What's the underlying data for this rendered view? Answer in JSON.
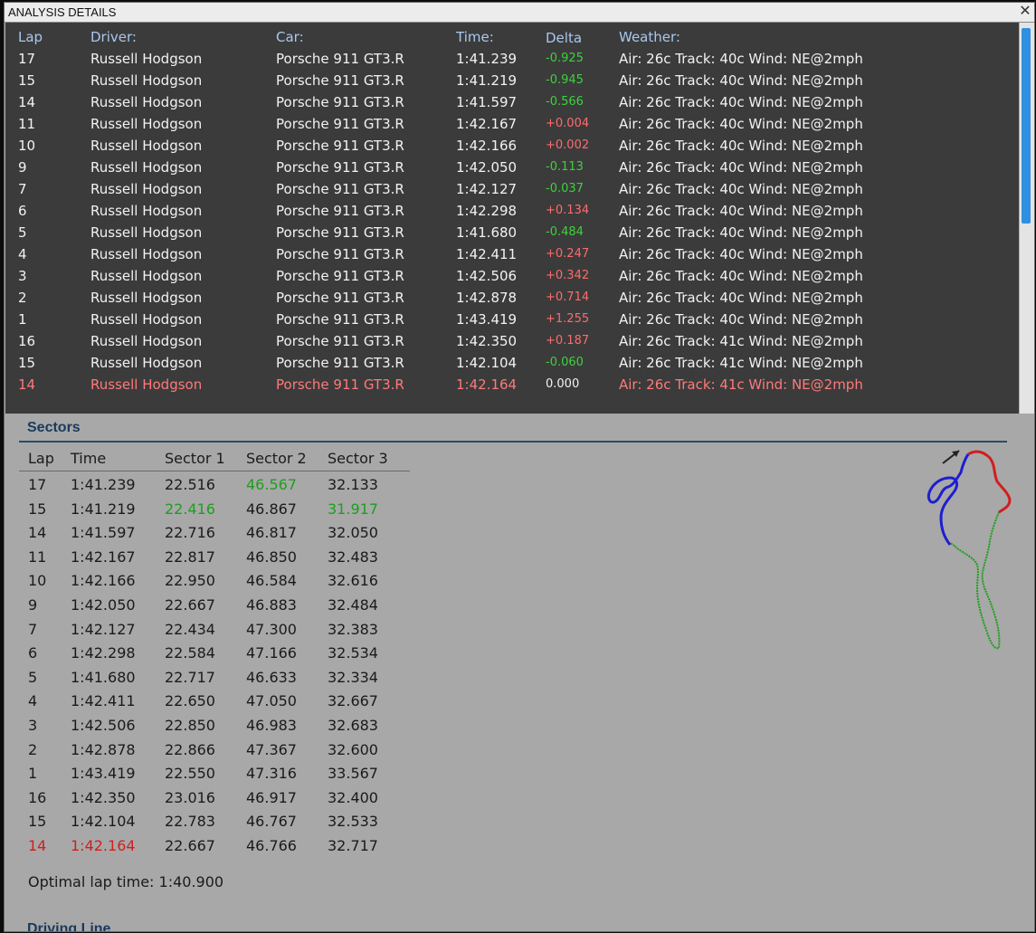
{
  "window": {
    "title": "ANALYSIS DETAILS",
    "close_glyph": "✕"
  },
  "laps": {
    "headers": {
      "lap": "Lap",
      "driver": "Driver:",
      "car": "Car:",
      "time": "Time:",
      "delta": "Delta",
      "weather": "Weather:"
    },
    "rows": [
      {
        "lap": "17",
        "driver": "Russell Hodgson",
        "car": "Porsche 911 GT3.R",
        "time": "1:41.239",
        "delta": "-0.925",
        "weather": "Air: 26c Track: 40c Wind: NE@2mph"
      },
      {
        "lap": "15",
        "driver": "Russell Hodgson",
        "car": "Porsche 911 GT3.R",
        "time": "1:41.219",
        "delta": "-0.945",
        "weather": "Air: 26c Track: 40c Wind: NE@2mph"
      },
      {
        "lap": "14",
        "driver": "Russell Hodgson",
        "car": "Porsche 911 GT3.R",
        "time": "1:41.597",
        "delta": "-0.566",
        "weather": "Air: 26c Track: 40c Wind: NE@2mph"
      },
      {
        "lap": "11",
        "driver": "Russell Hodgson",
        "car": "Porsche 911 GT3.R",
        "time": "1:42.167",
        "delta": "+0.004",
        "weather": "Air: 26c Track: 40c Wind: NE@2mph"
      },
      {
        "lap": "10",
        "driver": "Russell Hodgson",
        "car": "Porsche 911 GT3.R",
        "time": "1:42.166",
        "delta": "+0.002",
        "weather": "Air: 26c Track: 40c Wind: NE@2mph"
      },
      {
        "lap": "9",
        "driver": "Russell Hodgson",
        "car": "Porsche 911 GT3.R",
        "time": "1:42.050",
        "delta": "-0.113",
        "weather": "Air: 26c Track: 40c Wind: NE@2mph"
      },
      {
        "lap": "7",
        "driver": "Russell Hodgson",
        "car": "Porsche 911 GT3.R",
        "time": "1:42.127",
        "delta": "-0.037",
        "weather": "Air: 26c Track: 40c Wind: NE@2mph"
      },
      {
        "lap": "6",
        "driver": "Russell Hodgson",
        "car": "Porsche 911 GT3.R",
        "time": "1:42.298",
        "delta": "+0.134",
        "weather": "Air: 26c Track: 40c Wind: NE@2mph"
      },
      {
        "lap": "5",
        "driver": "Russell Hodgson",
        "car": "Porsche 911 GT3.R",
        "time": "1:41.680",
        "delta": "-0.484",
        "weather": "Air: 26c Track: 40c Wind: NE@2mph"
      },
      {
        "lap": "4",
        "driver": "Russell Hodgson",
        "car": "Porsche 911 GT3.R",
        "time": "1:42.411",
        "delta": "+0.247",
        "weather": "Air: 26c Track: 40c Wind: NE@2mph"
      },
      {
        "lap": "3",
        "driver": "Russell Hodgson",
        "car": "Porsche 911 GT3.R",
        "time": "1:42.506",
        "delta": "+0.342",
        "weather": "Air: 26c Track: 40c Wind: NE@2mph"
      },
      {
        "lap": "2",
        "driver": "Russell Hodgson",
        "car": "Porsche 911 GT3.R",
        "time": "1:42.878",
        "delta": "+0.714",
        "weather": "Air: 26c Track: 40c Wind: NE@2mph"
      },
      {
        "lap": "1",
        "driver": "Russell Hodgson",
        "car": "Porsche 911 GT3.R",
        "time": "1:43.419",
        "delta": "+1.255",
        "weather": "Air: 26c Track: 40c Wind: NE@2mph"
      },
      {
        "lap": "16",
        "driver": "Russell Hodgson",
        "car": "Porsche 911 GT3.R",
        "time": "1:42.350",
        "delta": "+0.187",
        "weather": "Air: 26c Track: 41c Wind: NE@2mph"
      },
      {
        "lap": "15",
        "driver": "Russell Hodgson",
        "car": "Porsche 911 GT3.R",
        "time": "1:42.104",
        "delta": "-0.060",
        "weather": "Air: 26c Track: 41c Wind: NE@2mph"
      },
      {
        "lap": "14",
        "driver": "Russell Hodgson",
        "car": "Porsche 911 GT3.R",
        "time": "1:42.164",
        "delta": "0.000",
        "weather": "Air: 26c Track: 41c Wind: NE@2mph"
      }
    ]
  },
  "sectors": {
    "title": "Sectors",
    "headers": {
      "lap": "Lap",
      "time": "Time",
      "s1": "Sector 1",
      "s2": "Sector 2",
      "s3": "Sector 3"
    },
    "rows": [
      {
        "lap": "17",
        "time": "1:41.239",
        "s1": "22.516",
        "s2": "46.567",
        "s3": "32.133"
      },
      {
        "lap": "15",
        "time": "1:41.219",
        "s1": "22.416",
        "s2": "46.867",
        "s3": "31.917"
      },
      {
        "lap": "14",
        "time": "1:41.597",
        "s1": "22.716",
        "s2": "46.817",
        "s3": "32.050"
      },
      {
        "lap": "11",
        "time": "1:42.167",
        "s1": "22.817",
        "s2": "46.850",
        "s3": "32.483"
      },
      {
        "lap": "10",
        "time": "1:42.166",
        "s1": "22.950",
        "s2": "46.584",
        "s3": "32.616"
      },
      {
        "lap": "9",
        "time": "1:42.050",
        "s1": "22.667",
        "s2": "46.883",
        "s3": "32.484"
      },
      {
        "lap": "7",
        "time": "1:42.127",
        "s1": "22.434",
        "s2": "47.300",
        "s3": "32.383"
      },
      {
        "lap": "6",
        "time": "1:42.298",
        "s1": "22.584",
        "s2": "47.166",
        "s3": "32.534"
      },
      {
        "lap": "5",
        "time": "1:41.680",
        "s1": "22.717",
        "s2": "46.633",
        "s3": "32.334"
      },
      {
        "lap": "4",
        "time": "1:42.411",
        "s1": "22.650",
        "s2": "47.050",
        "s3": "32.667"
      },
      {
        "lap": "3",
        "time": "1:42.506",
        "s1": "22.850",
        "s2": "46.983",
        "s3": "32.683"
      },
      {
        "lap": "2",
        "time": "1:42.878",
        "s1": "22.866",
        "s2": "47.367",
        "s3": "32.600"
      },
      {
        "lap": "1",
        "time": "1:43.419",
        "s1": "22.550",
        "s2": "47.316",
        "s3": "33.567"
      },
      {
        "lap": "16",
        "time": "1:42.350",
        "s1": "23.016",
        "s2": "46.917",
        "s3": "32.400"
      },
      {
        "lap": "15",
        "time": "1:42.104",
        "s1": "22.783",
        "s2": "46.767",
        "s3": "32.533"
      },
      {
        "lap": "14",
        "time": "1:42.164",
        "s1": "22.667",
        "s2": "46.766",
        "s3": "32.717"
      }
    ],
    "optimal_lap": "Optimal lap time: 1:40.900"
  },
  "driving_line": {
    "title": "Driving Line"
  },
  "colors": {
    "best_sector": "#1d9e1d",
    "selected_row": "#d21e1e",
    "delta_negative": "#3cd23c",
    "delta_positive": "#ff6b6b",
    "track_sector1": "#d21e1e",
    "track_sector2": "#1e1ed2",
    "track_sector3": "#1d9e1d"
  },
  "icons": {
    "close": "close-icon",
    "direction": "direction-arrow-icon"
  }
}
